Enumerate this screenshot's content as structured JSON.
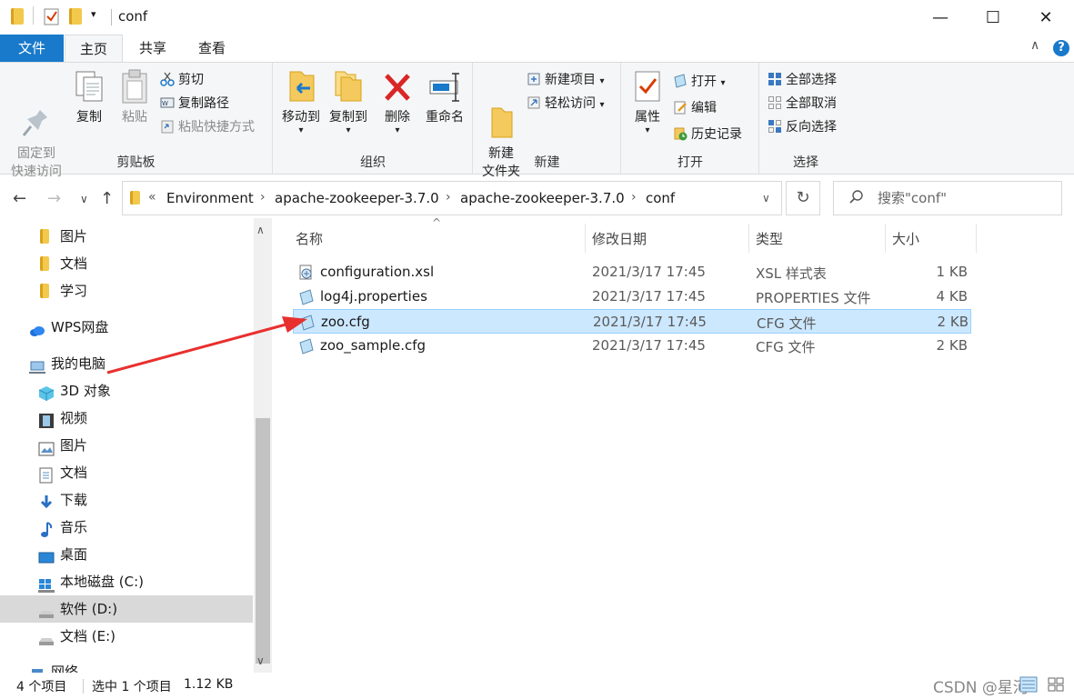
{
  "window": {
    "title": "conf",
    "controls": {
      "minimize": "—",
      "maximize": "☐",
      "close": "✕"
    }
  },
  "ribbon_tabs": [
    {
      "label": "文件"
    },
    {
      "label": "主页"
    },
    {
      "label": "共享"
    },
    {
      "label": "查看"
    }
  ],
  "ribbon": {
    "clipboard": {
      "label": "剪贴板",
      "pin": "固定到\n快速访问",
      "copy": "复制",
      "paste": "粘贴",
      "cut": "剪切",
      "copy_path": "复制路径",
      "paste_shortcut": "粘贴快捷方式"
    },
    "organize": {
      "label": "组织",
      "move_to": "移动到",
      "copy_to": "复制到",
      "delete": "删除",
      "rename": "重命名"
    },
    "new": {
      "label": "新建",
      "new_folder": "新建\n文件夹",
      "new_item": "新建项目",
      "easy_access": "轻松访问"
    },
    "open": {
      "label": "打开",
      "properties": "属性",
      "open": "打开",
      "edit": "编辑",
      "history": "历史记录"
    },
    "select": {
      "label": "选择",
      "select_all": "全部选择",
      "select_none": "全部取消",
      "invert": "反向选择"
    }
  },
  "address": {
    "overflow": "«",
    "crumbs": [
      "Environment",
      "apache-zookeeper-3.7.0",
      "apache-zookeeper-3.7.0",
      "conf"
    ],
    "search_placeholder": "搜索\"conf\""
  },
  "sidebar": {
    "items": [
      {
        "label": "图片"
      },
      {
        "label": "文档"
      },
      {
        "label": "学习"
      },
      {
        "label": "WPS网盘"
      },
      {
        "label": "我的电脑"
      },
      {
        "label": "3D 对象"
      },
      {
        "label": "视频"
      },
      {
        "label": "图片"
      },
      {
        "label": "文档"
      },
      {
        "label": "下载"
      },
      {
        "label": "音乐"
      },
      {
        "label": "桌面"
      },
      {
        "label": "本地磁盘 (C:)"
      },
      {
        "label": "软件 (D:)"
      },
      {
        "label": "文档 (E:)"
      },
      {
        "label": "网络"
      }
    ]
  },
  "filelist": {
    "columns": {
      "name": "名称",
      "modified": "修改日期",
      "type": "类型",
      "size": "大小"
    },
    "rows": [
      {
        "name": "configuration.xsl",
        "modified": "2021/3/17 17:45",
        "type": "XSL 样式表",
        "size": "1 KB"
      },
      {
        "name": "log4j.properties",
        "modified": "2021/3/17 17:45",
        "type": "PROPERTIES 文件",
        "size": "4 KB"
      },
      {
        "name": "zoo.cfg",
        "modified": "2021/3/17 17:45",
        "type": "CFG 文件",
        "size": "2 KB"
      },
      {
        "name": "zoo_sample.cfg",
        "modified": "2021/3/17 17:45",
        "type": "CFG 文件",
        "size": "2 KB"
      }
    ]
  },
  "status": {
    "count": "4 个项目",
    "selected": "选中 1 个项目",
    "selected_size": "1.12 KB",
    "watermark": "CSDN @星河"
  },
  "colors": {
    "accent": "#1979ca",
    "selection": "#cce8ff",
    "annotation_arrow": "#e8302e"
  }
}
